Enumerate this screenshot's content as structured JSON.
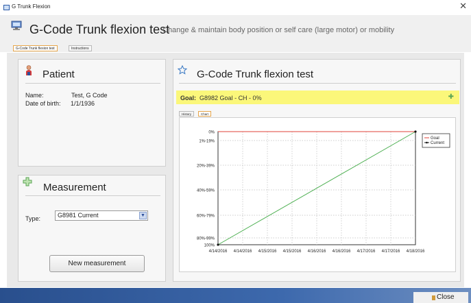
{
  "window": {
    "title": "G Trunk Flexion"
  },
  "header": {
    "title": "G-Code Trunk flexion test",
    "subtitle": "Change & maintain body position or self care (large motor) or mobility"
  },
  "tabs": [
    {
      "label": "G-Code Trunk flexion test",
      "active": true
    },
    {
      "label": "Instructions",
      "active": false
    }
  ],
  "patient": {
    "title": "Patient",
    "name_label": "Name:",
    "name_value": "Test, G Code",
    "dob_label": "Date of birth:",
    "dob_value": "1/1/1936"
  },
  "measurement": {
    "title": "Measurement",
    "type_label": "Type:",
    "type_value": "G8981 Current",
    "button_label": "New measurement"
  },
  "test_panel": {
    "title": "G-Code Trunk flexion test",
    "goal_label": "Goal:",
    "goal_value": "G8982 Goal - CH - 0%",
    "subtabs": [
      {
        "label": "History",
        "active": false
      },
      {
        "label": "Chart",
        "active": true
      }
    ]
  },
  "footer": {
    "close_label": "Close"
  },
  "chart_data": {
    "type": "line",
    "y_categories": [
      "0%",
      "1%-19%",
      "20%-39%",
      "40%-59%",
      "60%-79%",
      "80%-99%",
      "100%"
    ],
    "x_tick_labels": [
      "4/14/2016",
      "4/14/2016",
      "4/15/2016",
      "4/15/2016",
      "4/16/2016",
      "4/16/2016",
      "4/17/2016",
      "4/17/2016",
      "4/18/2016"
    ],
    "series": [
      {
        "name": "Goal",
        "color": "#e0403a",
        "points": [
          [
            "4/14/2016",
            "0%"
          ],
          [
            "4/18/2016",
            "0%"
          ]
        ]
      },
      {
        "name": "Current",
        "color": "#4caf50",
        "points": [
          [
            "4/14/2016",
            "100%"
          ],
          [
            "4/18/2016",
            "0%"
          ]
        ]
      }
    ],
    "legend": {
      "position": "top-right",
      "entries": [
        "Goal",
        "Current"
      ]
    },
    "grid": true
  }
}
